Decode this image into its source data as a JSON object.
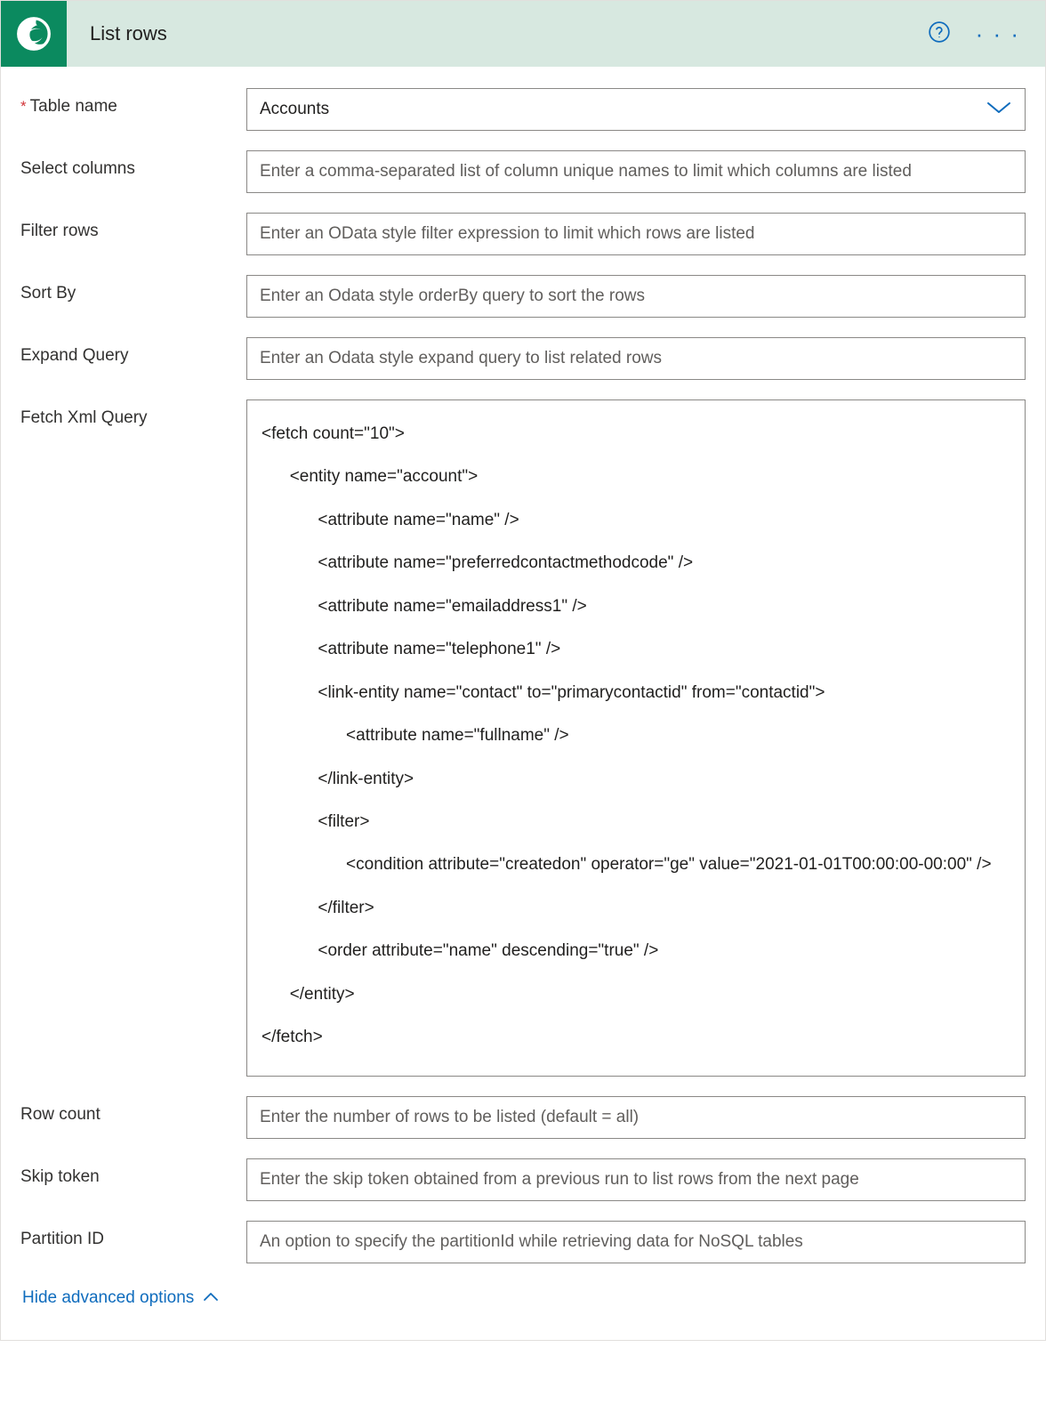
{
  "header": {
    "title": "List rows"
  },
  "fields": {
    "table_name": {
      "label": "Table name",
      "required": true,
      "value": "Accounts"
    },
    "select_columns": {
      "label": "Select columns",
      "placeholder": "Enter a comma-separated list of column unique names to limit which columns are listed"
    },
    "filter_rows": {
      "label": "Filter rows",
      "placeholder": "Enter an OData style filter expression to limit which rows are listed"
    },
    "sort_by": {
      "label": "Sort By",
      "placeholder": "Enter an Odata style orderBy query to sort the rows"
    },
    "expand_query": {
      "label": "Expand Query",
      "placeholder": "Enter an Odata style expand query to list related rows"
    },
    "fetch_xml_query": {
      "label": "Fetch Xml Query",
      "value": "<fetch count=\"10\">\n      <entity name=\"account\">\n            <attribute name=\"name\" />\n            <attribute name=\"preferredcontactmethodcode\" />\n            <attribute name=\"emailaddress1\" />\n            <attribute name=\"telephone1\" />\n            <link-entity name=\"contact\" to=\"primarycontactid\" from=\"contactid\">\n                  <attribute name=\"fullname\" />\n            </link-entity>\n            <filter>\n                  <condition attribute=\"createdon\" operator=\"ge\" value=\"2021-01-01T00:00:00-00:00\" />\n            </filter>\n            <order attribute=\"name\" descending=\"true\" />\n      </entity>\n</fetch>"
    },
    "row_count": {
      "label": "Row count",
      "placeholder": "Enter the number of rows to be listed (default = all)"
    },
    "skip_token": {
      "label": "Skip token",
      "placeholder": "Enter the skip token obtained from a previous run to list rows from the next page"
    },
    "partition_id": {
      "label": "Partition ID",
      "placeholder": "An option to specify the partitionId while retrieving data for NoSQL tables"
    }
  },
  "footer": {
    "hide_label": "Hide advanced options"
  }
}
